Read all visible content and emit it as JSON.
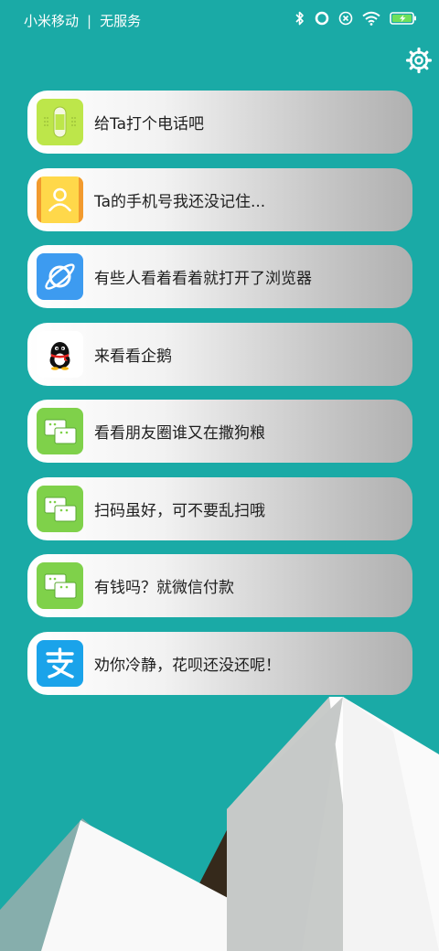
{
  "status_bar": {
    "carrier": "小米移动",
    "separator": "|",
    "service": "无服务",
    "icons": [
      "bluetooth-icon",
      "ring-icon",
      "alarm-x-icon",
      "wifi-icon",
      "battery-charging-icon"
    ]
  },
  "settings": {
    "icon": "gear-icon"
  },
  "cards": [
    {
      "label": "给Ta打个电话吧",
      "icon": "phone-app-icon"
    },
    {
      "label": "Ta的手机号我还没记住...",
      "icon": "contacts-app-icon"
    },
    {
      "label": "有些人看着看着就打开了浏览器",
      "icon": "browser-app-icon"
    },
    {
      "label": "来看看企鹅",
      "icon": "qq-penguin-icon"
    },
    {
      "label": "看看朋友圈谁又在撒狗粮",
      "icon": "wechat-moments-icon"
    },
    {
      "label": "扫码虽好，可不要乱扫哦",
      "icon": "wechat-scan-icon"
    },
    {
      "label": "有钱吗？就微信付款",
      "icon": "wechat-pay-icon"
    },
    {
      "label": "劝你冷静，花呗还没还呢！",
      "icon": "alipay-icon"
    }
  ],
  "colors": {
    "background": "#1aaaa6",
    "wechat_green": "#7fd14a",
    "alipay_blue": "#1aa3ea",
    "browser_blue": "#3d9bf0",
    "phone_lime": "#bde64a",
    "contacts_yellow": "#ffd84a"
  }
}
